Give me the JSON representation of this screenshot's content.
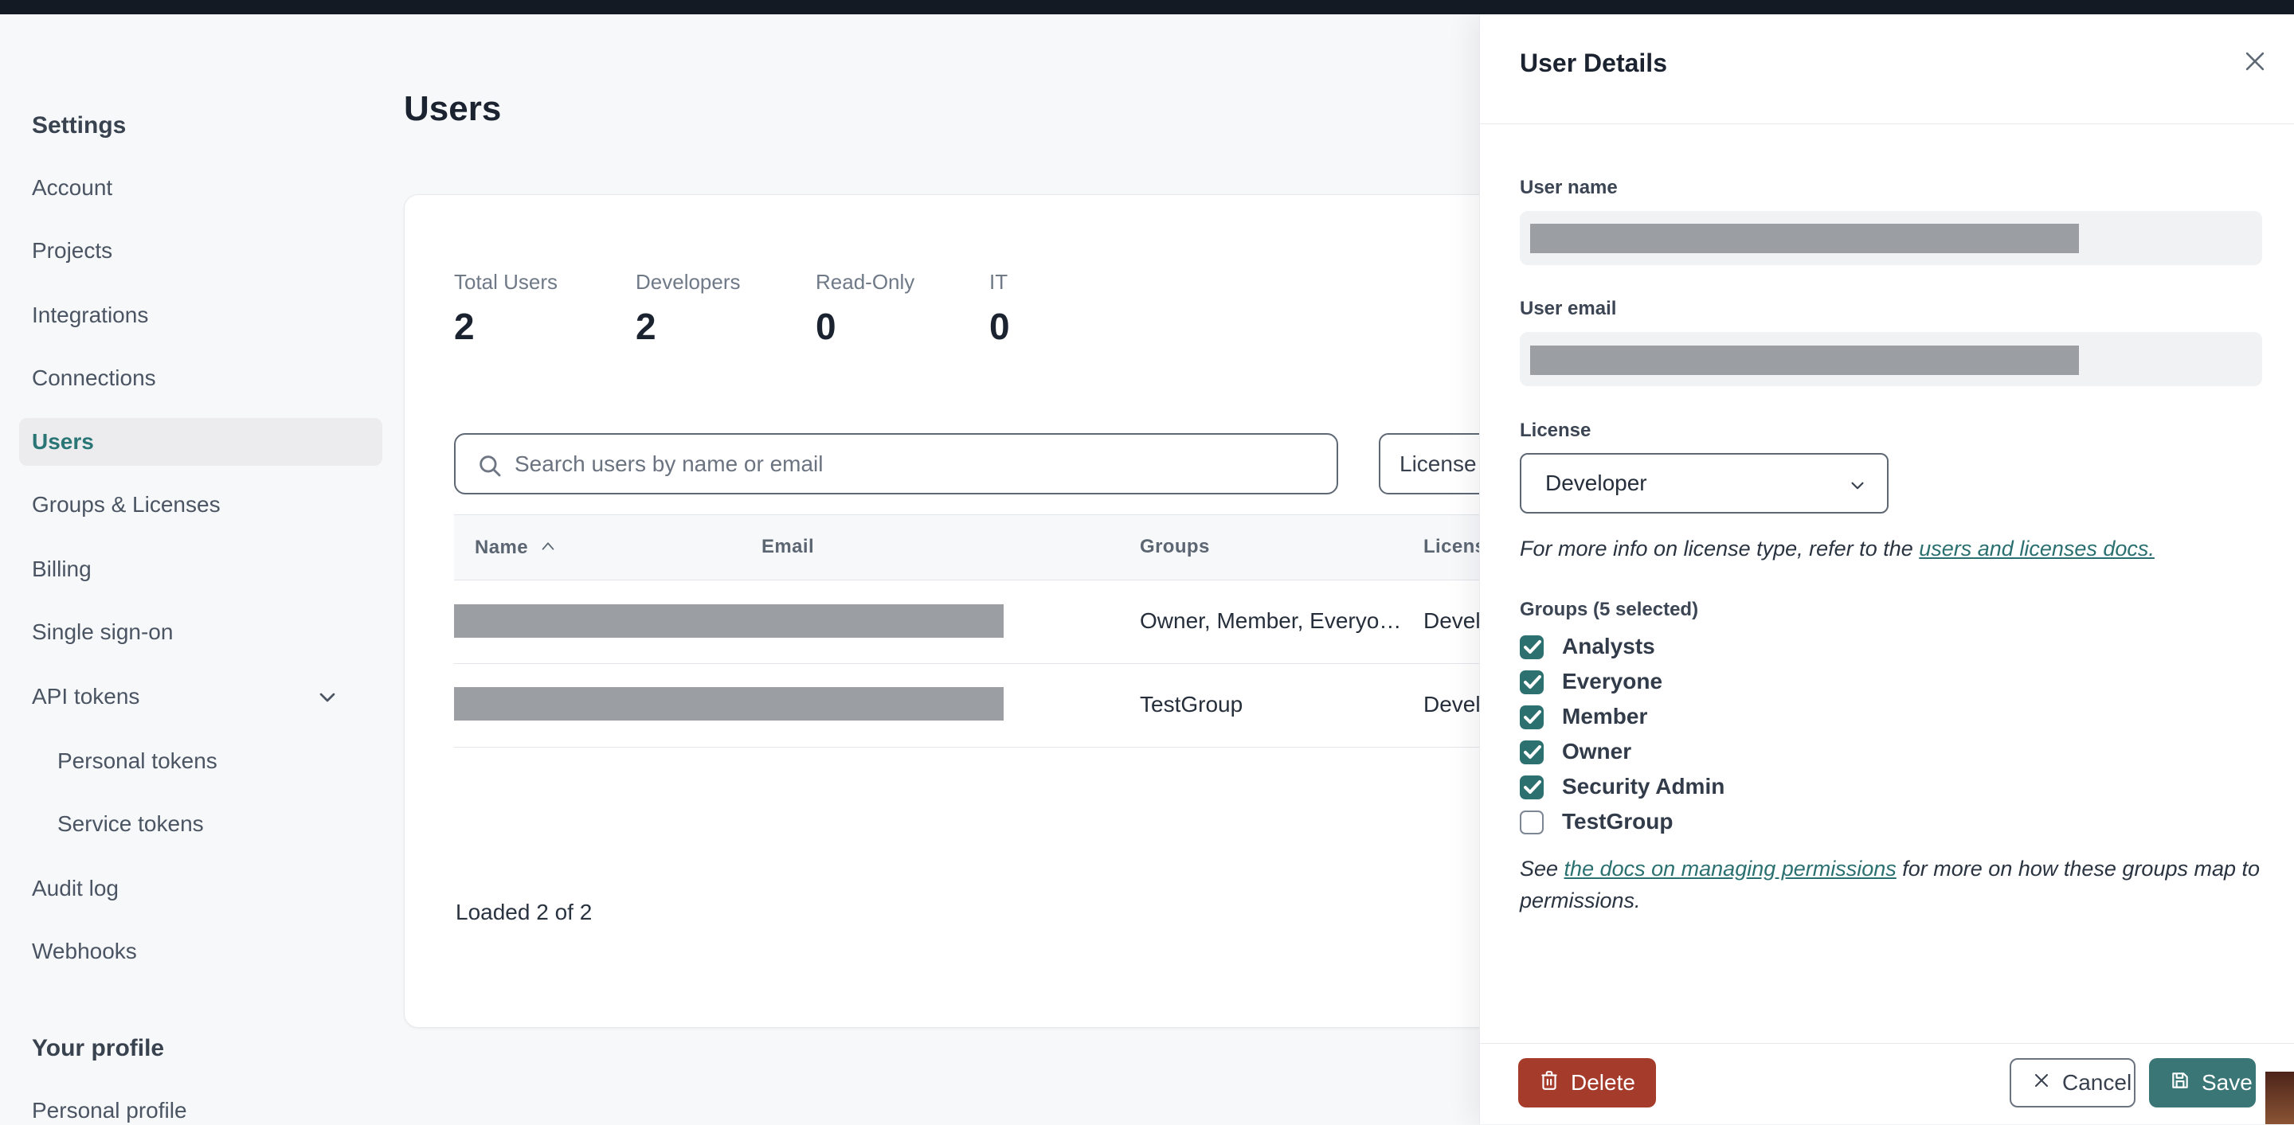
{
  "topbar": {
    "color": "#141a24"
  },
  "sidebar": {
    "settings_heading": "Settings",
    "items": [
      {
        "label": "Account"
      },
      {
        "label": "Projects"
      },
      {
        "label": "Integrations"
      },
      {
        "label": "Connections"
      },
      {
        "label": "Users",
        "active": true
      },
      {
        "label": "Groups & Licenses"
      },
      {
        "label": "Billing"
      },
      {
        "label": "Single sign-on"
      },
      {
        "label": "API tokens",
        "expandable": true
      },
      {
        "label": "Personal tokens",
        "child": true
      },
      {
        "label": "Service tokens",
        "child": true
      },
      {
        "label": "Audit log"
      },
      {
        "label": "Webhooks"
      }
    ],
    "profile_heading": "Your profile",
    "profile_items": [
      {
        "label": "Personal profile"
      }
    ]
  },
  "main": {
    "title": "Users",
    "stats": [
      {
        "label": "Total Users",
        "value": "2"
      },
      {
        "label": "Developers",
        "value": "2"
      },
      {
        "label": "Read-Only",
        "value": "0"
      },
      {
        "label": "IT",
        "value": "0"
      }
    ],
    "search": {
      "placeholder": "Search users by name or email",
      "value": ""
    },
    "license_filter_label": "License",
    "table": {
      "headers": [
        "Name",
        "Email",
        "Groups",
        "License"
      ],
      "sort": {
        "column": "Name",
        "direction": "ascending"
      },
      "rows": [
        {
          "name": "[redacted]",
          "email": "[redacted]",
          "groups": "Owner, Member, Everyo…",
          "license": "Developer"
        },
        {
          "name": "[redacted]",
          "email": "[redacted]",
          "groups": "TestGroup",
          "license": "Developer"
        }
      ]
    },
    "loaded_text": "Loaded 2 of 2"
  },
  "panel": {
    "title": "User Details",
    "user_name_label": "User name",
    "user_name_value": "[redacted]",
    "user_email_label": "User email",
    "user_email_value": "[redacted]",
    "license_label": "License",
    "license_value": "Developer",
    "license_note_prefix": "For more info on license type, refer to the ",
    "license_note_link": "users and licenses docs.",
    "groups_label": "Groups (5 selected)",
    "groups": {
      "options": [
        {
          "label": "Analysts",
          "checked": true
        },
        {
          "label": "Everyone",
          "checked": true
        },
        {
          "label": "Member",
          "checked": true
        },
        {
          "label": "Owner",
          "checked": true
        },
        {
          "label": "Security Admin",
          "checked": true
        },
        {
          "label": "TestGroup",
          "checked": false
        }
      ]
    },
    "permissions_note_prefix": "See ",
    "permissions_note_link": "the docs on managing permissions",
    "permissions_note_suffix": " for more on how these groups map to permissions.",
    "footer": {
      "delete_label": "Delete",
      "cancel_label": "Cancel",
      "save_label": "Save"
    }
  },
  "colors": {
    "accent_teal": "#2d7070",
    "save_teal": "#3b7676",
    "delete_red": "#a53b2b",
    "redaction_gray": "#9b9fa3",
    "topbar_dark": "#141a24",
    "page_bg": "#f7f8f9"
  }
}
